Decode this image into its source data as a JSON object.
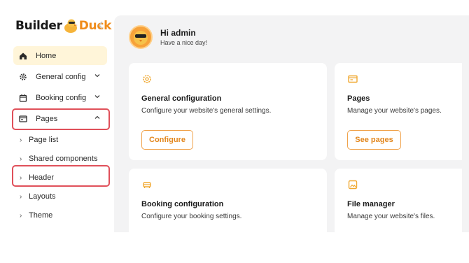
{
  "brand": {
    "part1": "Builder",
    "part2": "Duck"
  },
  "sidebar": {
    "items": [
      {
        "label": "Home",
        "icon": "home-icon"
      },
      {
        "label": "General config",
        "icon": "gear-icon"
      },
      {
        "label": "Booking config",
        "icon": "calendar-icon"
      },
      {
        "label": "Pages",
        "icon": "pages-icon"
      }
    ],
    "subitems": [
      {
        "label": "Page list"
      },
      {
        "label": "Shared components"
      },
      {
        "label": "Header"
      },
      {
        "label": "Layouts"
      },
      {
        "label": "Theme"
      }
    ]
  },
  "header": {
    "greeting": "Hi admin",
    "subtitle": "Have a nice day!"
  },
  "cards": [
    {
      "title": "General configuration",
      "description": "Configure your website's general settings.",
      "button": "Configure",
      "icon": "gear-icon"
    },
    {
      "title": "Pages",
      "description": "Manage your website's pages.",
      "button": "See pages",
      "icon": "pages-icon"
    },
    {
      "title": "Booking configuration",
      "description": "Configure your booking settings.",
      "icon": "car-icon"
    },
    {
      "title": "File manager",
      "description": "Manage your website's files.",
      "icon": "image-icon"
    }
  ],
  "colors": {
    "accent": "#f08c1a",
    "highlight": "#e0505a",
    "active_bg": "#fff5d9",
    "main_bg": "#f3f3f4"
  }
}
